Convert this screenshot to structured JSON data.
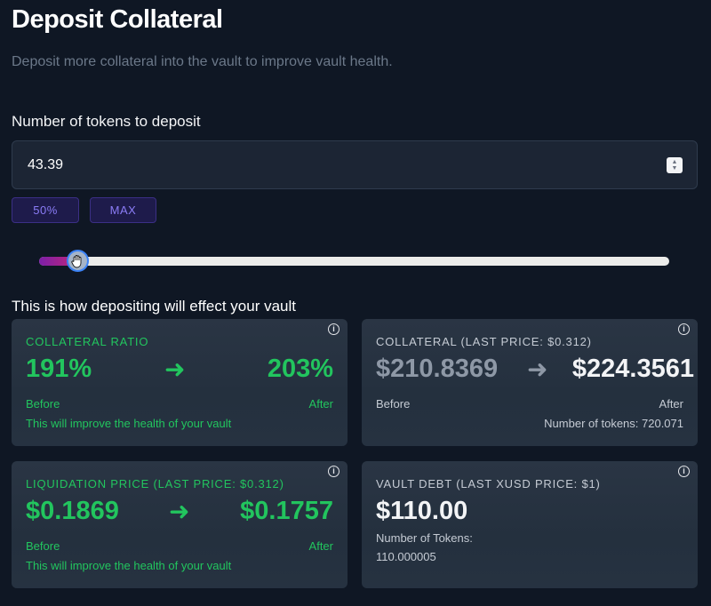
{
  "header": {
    "title": "Deposit Collateral",
    "subtitle": "Deposit more collateral into the vault to improve vault health."
  },
  "deposit": {
    "label": "Number of tokens to deposit",
    "value": "43.39",
    "buttons": {
      "half": "50%",
      "max": "MAX"
    },
    "slider_fraction": 0.06
  },
  "effect": {
    "heading": "This is how depositing will effect your vault",
    "collateral_ratio": {
      "label": "COLLATERAL RATIO",
      "before": "191%",
      "after": "203%",
      "before_label": "Before",
      "after_label": "After",
      "note": "This will improve the health of your vault"
    },
    "collateral": {
      "label": "COLLATERAL (LAST PRICE: $0.312)",
      "before": "$210.8369",
      "after": "$224.3561",
      "before_label": "Before",
      "after_label": "After",
      "tokens": "Number of tokens: 720.071"
    },
    "liquidation_price": {
      "label": "LIQUIDATION PRICE (LAST PRICE: $0.312)",
      "before": "$0.1869",
      "after": "$0.1757",
      "before_label": "Before",
      "after_label": "After",
      "note": "This will improve the health of your vault"
    },
    "vault_debt": {
      "label": "VAULT DEBT (LAST XUSD PRICE: $1)",
      "value": "$110.00",
      "tokens_label": "Number of Tokens:",
      "tokens_value": "110.000005"
    }
  },
  "colors": {
    "background": "#0f1724",
    "accent_green": "#22c55e",
    "button_purple": "#8b7cf6",
    "slider_gradient": [
      "#7c1fa8",
      "#c0267a"
    ]
  },
  "icons": {
    "info": "info-icon",
    "arrow": "arrow-right-icon",
    "cursor": "grab-hand-cursor-icon"
  }
}
